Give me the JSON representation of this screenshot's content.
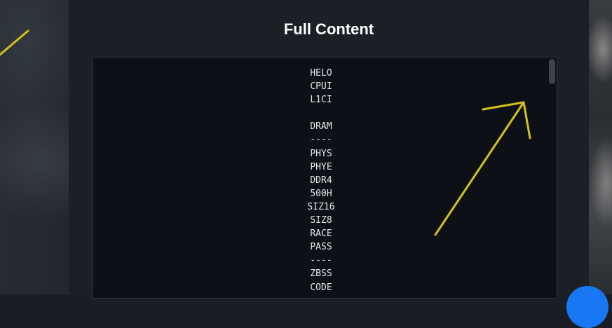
{
  "dialog": {
    "title": "Full Content"
  },
  "content": {
    "lines": [
      "HELO",
      "CPUI",
      "L1CI",
      "",
      "DRAM",
      "----",
      "PHYS",
      "PHYE",
      "DDR4",
      "500H",
      "SIZ16",
      "SIZ8",
      "RACE",
      "PASS",
      "----",
      "ZBSS",
      "CODE"
    ]
  },
  "colors": {
    "background": "#1a1e24",
    "panel": "#1b2027",
    "content_bg": "#0d1117",
    "text": "#e6e6e6",
    "annotation": "#d4c21a",
    "fab": "#1877f2"
  }
}
